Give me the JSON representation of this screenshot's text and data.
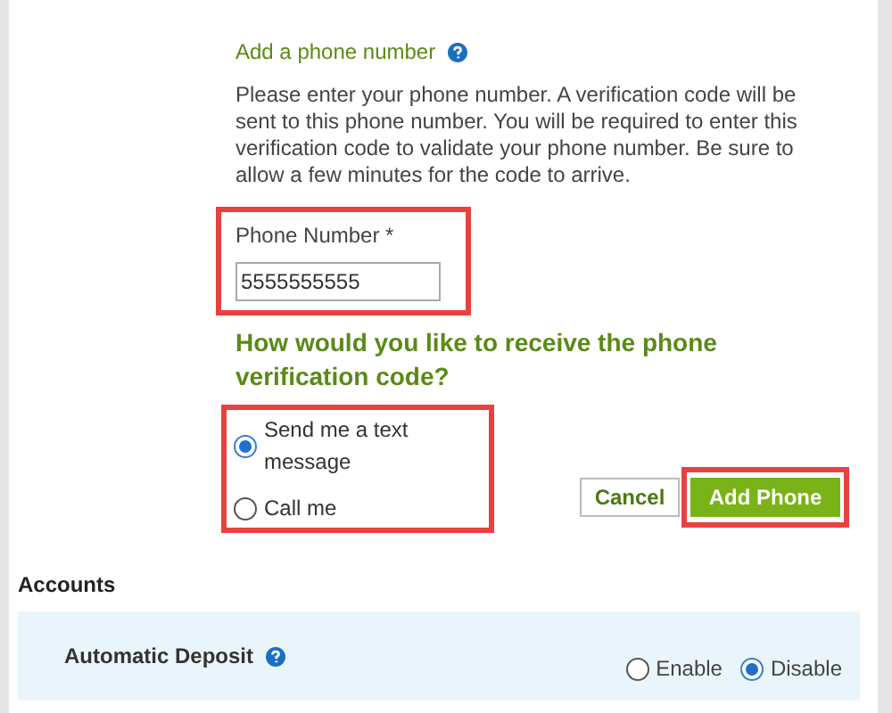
{
  "phone_form": {
    "title": "Add a phone number",
    "description": "Please enter your phone number. A verification code will be sent to this phone number. You will be required to enter this verification code to validate your phone number. Be sure to allow a few minutes for the code to arrive.",
    "phone_field": {
      "label": "Phone Number *",
      "value": "5555555555"
    },
    "question": "How would you like to receive the phone verification code?",
    "options": [
      {
        "label": "Send me a text message",
        "selected": true
      },
      {
        "label": "Call me",
        "selected": false
      }
    ],
    "buttons": [
      {
        "kind": "secondary",
        "label": "Cancel"
      },
      {
        "kind": "primary",
        "label": "Add Phone"
      }
    ]
  },
  "accounts": {
    "heading": "Accounts",
    "setting": {
      "label": "Automatic Deposit",
      "options": [
        {
          "label": "Enable",
          "selected": false
        },
        {
          "label": "Disable",
          "selected": true
        }
      ]
    }
  }
}
